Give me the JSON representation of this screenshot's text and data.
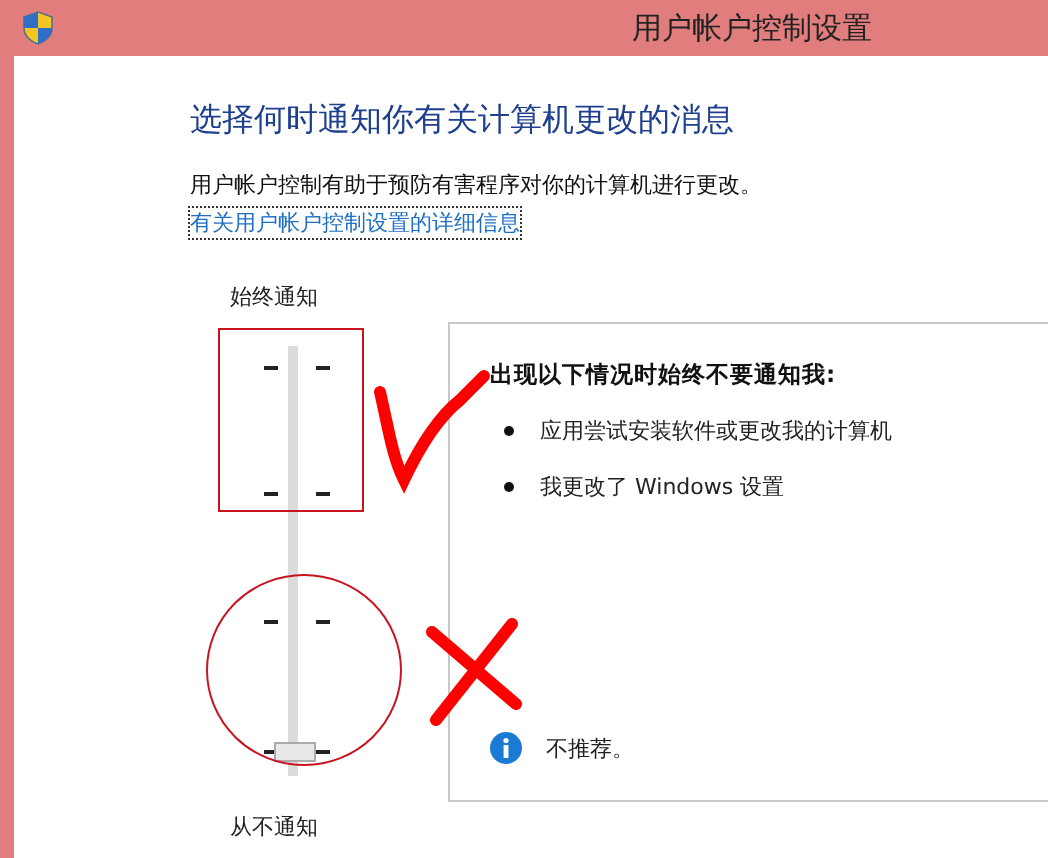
{
  "window": {
    "title": "用户帐户控制设置"
  },
  "heading": "选择何时通知你有关计算机更改的消息",
  "description": "用户帐户控制有助于预防有害程序对你的计算机进行更改。",
  "link": "有关用户帐户控制设置的详细信息",
  "slider": {
    "top_label": "始终通知",
    "bottom_label": "从不通知",
    "level": 0
  },
  "panel": {
    "title": "出现以下情况时始终不要通知我:",
    "bullets": [
      "应用尝试安装软件或更改我的计算机",
      "我更改了 Windows 设置"
    ],
    "note": "不推荐。"
  },
  "annotations": [
    {
      "kind": "rectangle"
    },
    {
      "kind": "circle"
    },
    {
      "kind": "check"
    },
    {
      "kind": "cross"
    }
  ]
}
